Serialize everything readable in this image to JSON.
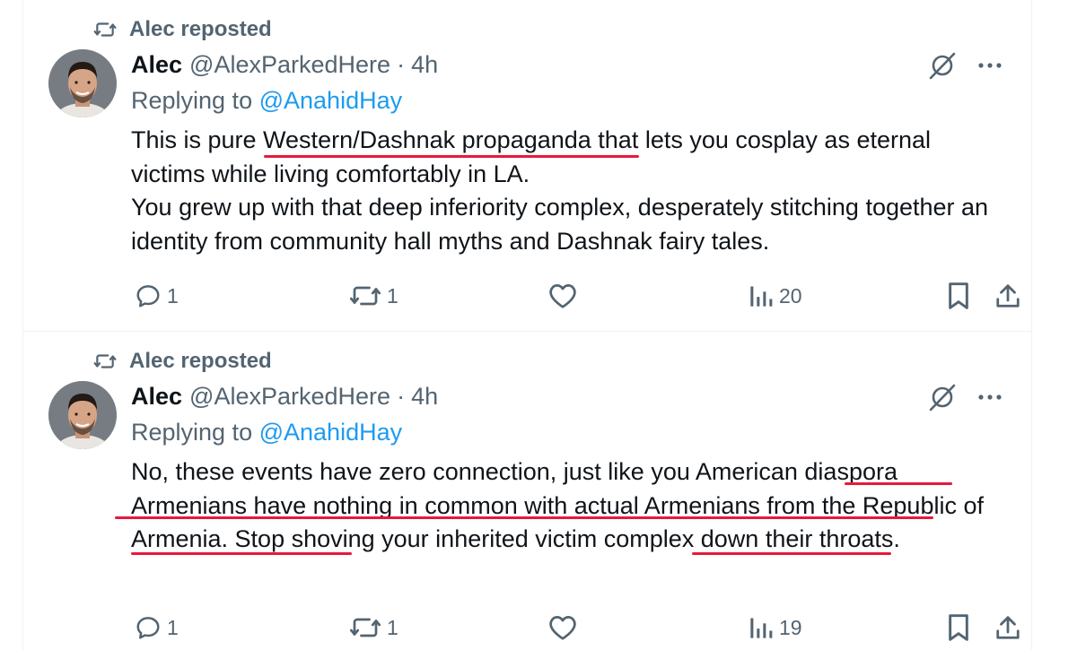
{
  "colors": {
    "text": "#0f1419",
    "muted": "#536471",
    "mention": "#1d9bf0",
    "annotation": "#e8193c"
  },
  "icons": {
    "repost": "repost-icon",
    "grok": "grok-icon",
    "more": "more-icon",
    "reply": "reply-icon",
    "like": "heart-icon",
    "views": "views-icon",
    "bookmark": "bookmark-icon",
    "share": "share-icon"
  },
  "posts": [
    {
      "repost_label": "Alec reposted",
      "author": {
        "name": "Alec",
        "handle": "@AlexParkedHere",
        "separator": "·",
        "time": "4h"
      },
      "replying_prefix": "Replying to",
      "replying_to": "@AnahidHay",
      "paragraphs": [
        "This is pure Western/Dashnak propaganda that lets you cosplay as eternal victims while living comfortably in LA.",
        "You grew up with that deep inferiority complex, desperately stitching together an identity from community hall myths and Dashnak fairy tales."
      ],
      "stats": {
        "replies": "1",
        "reposts": "1",
        "likes": "",
        "views": "20"
      }
    },
    {
      "repost_label": "Alec reposted",
      "author": {
        "name": "Alec",
        "handle": "@AlexParkedHere",
        "separator": "·",
        "time": "4h"
      },
      "replying_prefix": "Replying to",
      "replying_to": "@AnahidHay",
      "paragraphs": [
        "No, these events have zero connection, just like you American diaspora Armenians have nothing in common with actual Armenians from the Republic of Armenia. Stop shoving your inherited victim complex down their throats."
      ],
      "stats": {
        "replies": "1",
        "reposts": "1",
        "likes": "",
        "views": "19"
      }
    }
  ]
}
